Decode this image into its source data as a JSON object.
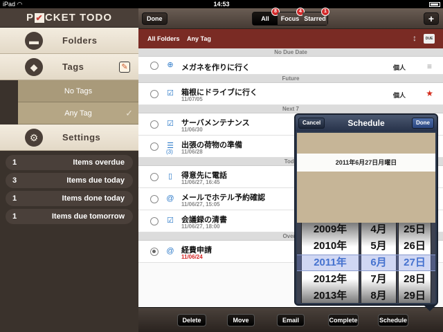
{
  "statusbar": {
    "device": "iPad",
    "wifi_icon": "wifi-icon",
    "time": "14:53",
    "battery_icon": "battery-icon"
  },
  "sidebar": {
    "logo": {
      "before": "P",
      "check": "✔",
      "after": "CKET TODO"
    },
    "folders_label": "Folders",
    "tags_label": "Tags",
    "settings_label": "Settings",
    "tag_items": [
      {
        "label": "No Tags"
      },
      {
        "label": "Any Tag"
      }
    ],
    "stats": [
      {
        "count": "1",
        "label": "Items overdue"
      },
      {
        "count": "3",
        "label": "Items due today"
      },
      {
        "count": "1",
        "label": "Items done today"
      },
      {
        "count": "1",
        "label": "Items due tomorrow"
      }
    ]
  },
  "topbar": {
    "done_label": "Done",
    "plus_label": "+",
    "segments": [
      {
        "label": "All",
        "badge": "8"
      },
      {
        "label": "Focus",
        "badge": "4"
      },
      {
        "label": "Starred",
        "badge": "1"
      }
    ]
  },
  "filterbar": {
    "folder": "All Folders",
    "tag": "Any Tag",
    "due_icon_label": "DUE"
  },
  "sections": {
    "no_due": "No Due Date",
    "future": "Future",
    "next7": "Next 7",
    "today": "Toda",
    "overdue": "Overd"
  },
  "tasks": [
    {
      "title": "メガネを作りに行く",
      "date": "",
      "tag": "個人"
    },
    {
      "title": "箱根にドライブに行く",
      "date": "11/07/05",
      "tag": "個人"
    },
    {
      "title": "サーバメンテナンス",
      "date": "11/06/30"
    },
    {
      "title": "出張の荷物の準備",
      "date": "11/06/28",
      "sub": "(3)"
    },
    {
      "title": "得意先に電話",
      "date": "11/06/27, 16:45"
    },
    {
      "title": "メールでホテル予約確認",
      "date": "11/06/27, 15:05"
    },
    {
      "title": "会議録の清書",
      "date": "11/06/27, 18:00"
    },
    {
      "title": "経費申請",
      "date": "11/06/24"
    }
  ],
  "bottombar": {
    "delete": "Delete",
    "move": "Move",
    "email": "Email",
    "complete": "Complete",
    "schedule": "Schedule"
  },
  "schedule": {
    "title": "Schedule",
    "cancel": "Cancel",
    "done": "Done",
    "date_text": "2011年6月27日月曜日",
    "years": [
      "2009年",
      "2010年",
      "2011年",
      "2012年",
      "2013年"
    ],
    "months": [
      "4月",
      "5月",
      "6月",
      "7月",
      "8月"
    ],
    "days": [
      "25日",
      "26日",
      "27日",
      "28日",
      "29日"
    ],
    "selected_index": 2
  },
  "colors": {
    "accent_red": "#7a2b24",
    "link_blue": "#2a78c8",
    "overdue_red": "#d42222"
  }
}
